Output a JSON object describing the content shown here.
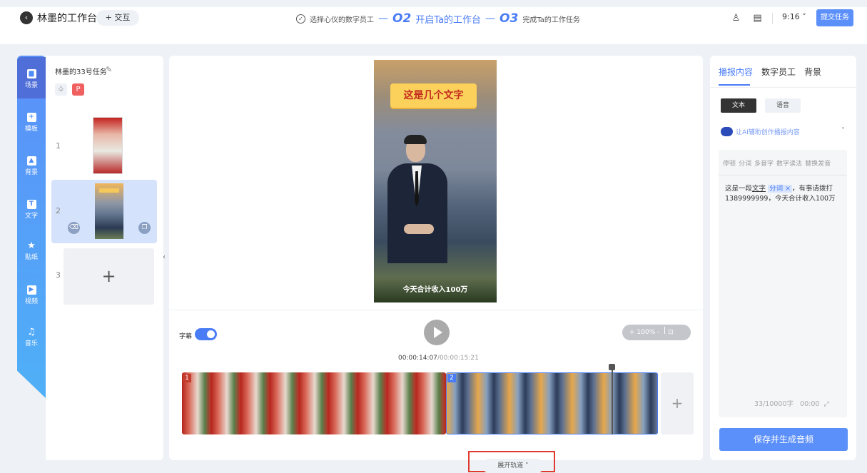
{
  "header": {
    "back_icon": "chevron-left-icon",
    "title": "林墨的工作台",
    "interact_label": "+ 交互",
    "step1_label": "选择心仪的数字员工",
    "step2_num": "O2",
    "step2_label": "开启Ta的工作台",
    "step3_num": "O3",
    "step3_label": "完成Ta的工作任务",
    "ratio": "9:16",
    "submit_label": "提交任务"
  },
  "nav": {
    "items": [
      {
        "label": "场景",
        "icon": "scene-icon"
      },
      {
        "label": "模板",
        "icon": "template-icon"
      },
      {
        "label": "背景",
        "icon": "image-icon"
      },
      {
        "label": "文字",
        "icon": "text-icon"
      },
      {
        "label": "贴纸",
        "icon": "star-icon"
      },
      {
        "label": "视频",
        "icon": "video-icon"
      },
      {
        "label": "音乐",
        "icon": "music-icon"
      }
    ]
  },
  "scenes": {
    "task_title": "林墨的33号任务",
    "items": [
      "1",
      "2",
      "3"
    ]
  },
  "canvas": {
    "headline": "这是几个文字",
    "caption": "今天合计收入100万"
  },
  "player": {
    "subtitle_label": "字幕",
    "current_time": "00:00:14:07",
    "total_time": "/00:00:15:21",
    "zoom": "+ 100% -",
    "expand_label": "展开轨道"
  },
  "right": {
    "tabs": [
      "播报内容",
      "数字员工",
      "背景"
    ],
    "seg_text": "文本",
    "seg_voice": "语音",
    "ai_label": "让AI辅助创作播报内容",
    "tools": [
      "停顿",
      "分词",
      "多音字",
      "数字读法",
      "替换发音"
    ],
    "body_a": "这是一段",
    "body_b": "文字",
    "body_tag": "分词 ×",
    "body_c": "，有事请拨打1389999999，今天合计收入100万",
    "count": "33/10000字",
    "duration": "00:00",
    "save_label": "保存并生成音频"
  }
}
